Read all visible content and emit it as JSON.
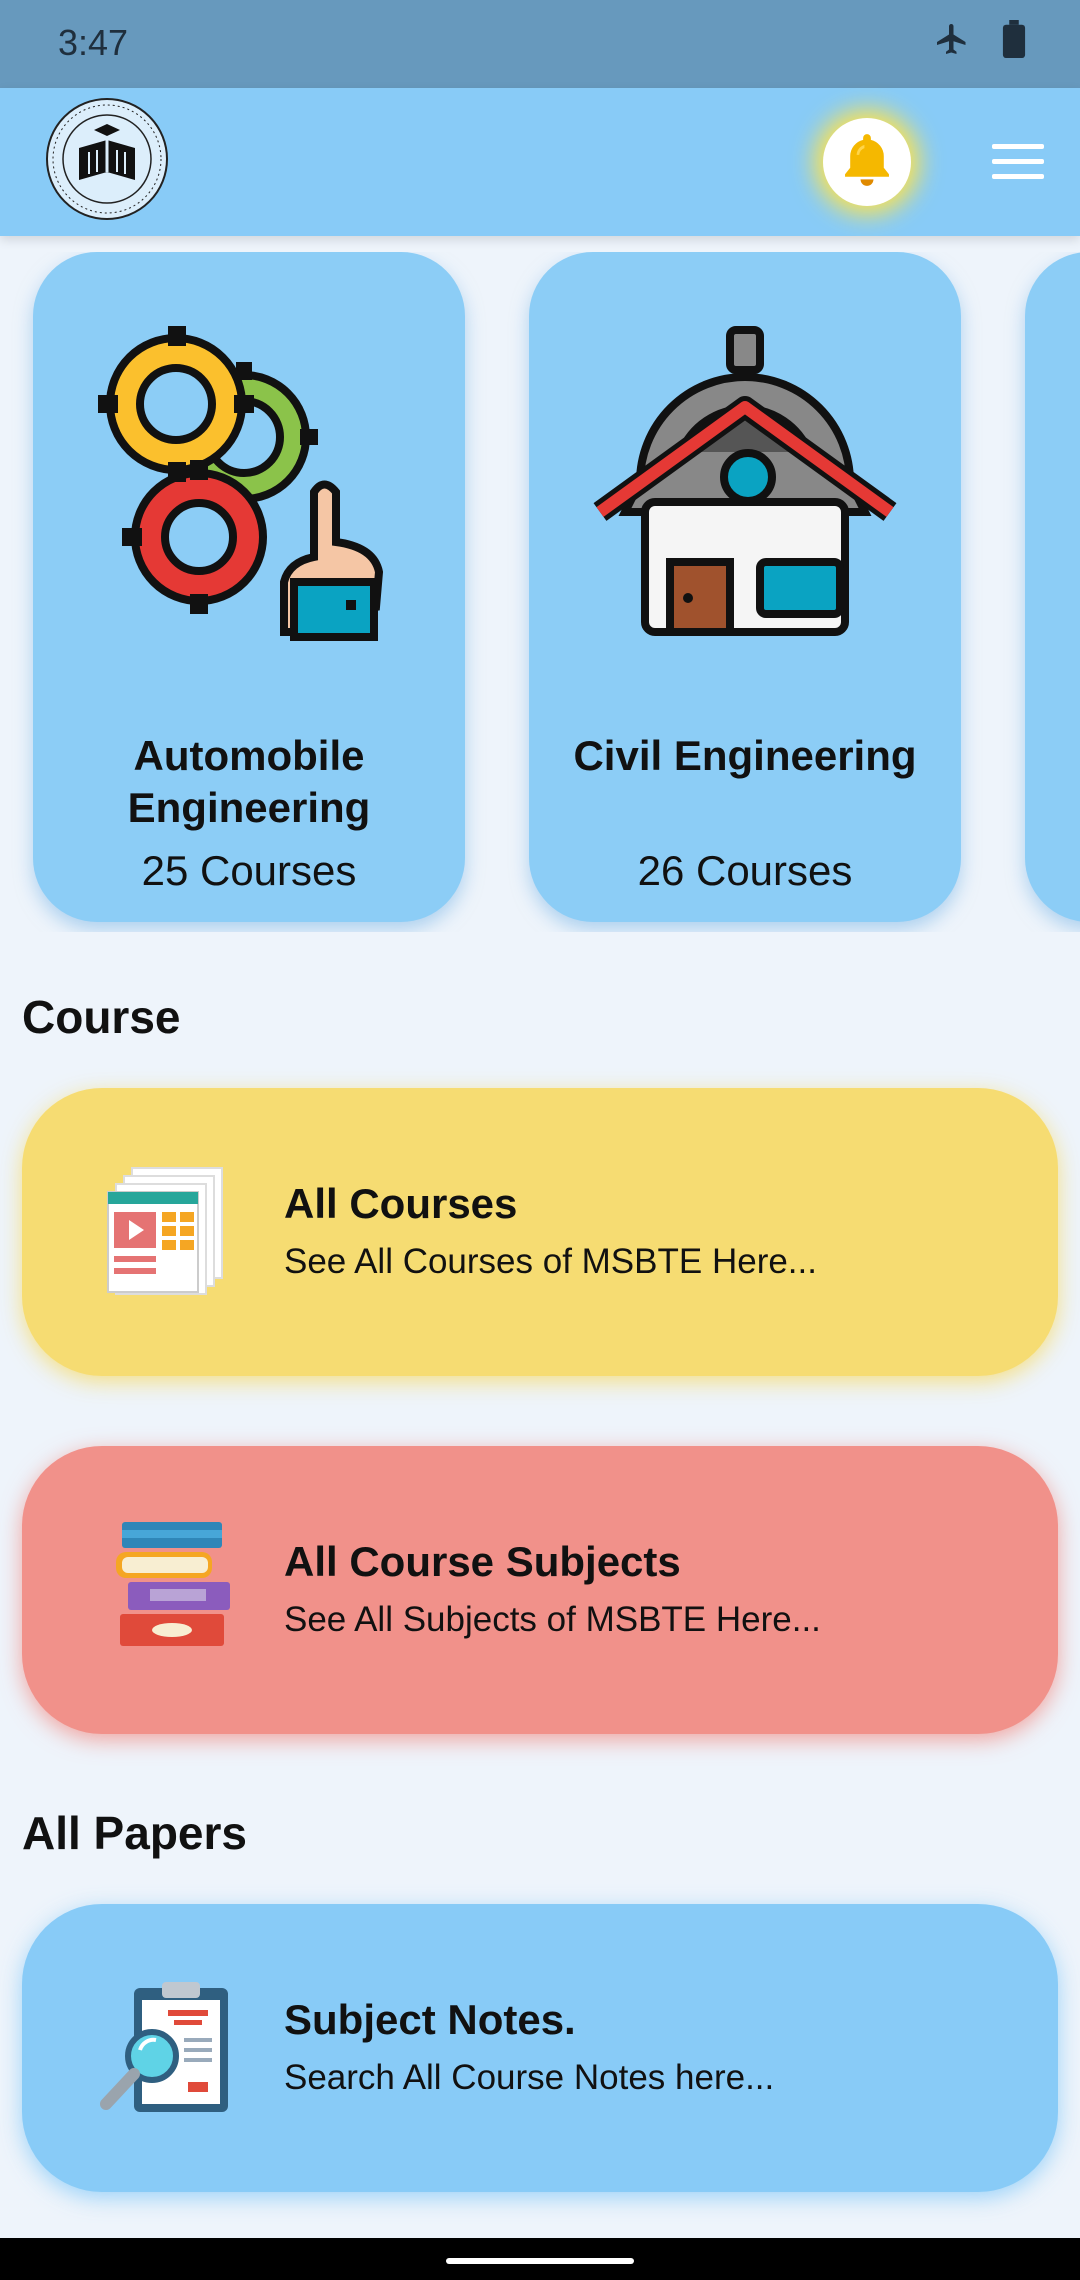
{
  "status_bar": {
    "time": "3:47",
    "icons": [
      "airplane-icon",
      "battery-icon"
    ]
  },
  "app_bar": {
    "logo": "msbte-seal-logo",
    "notification_icon": "bell-icon",
    "menu_icon": "hamburger-menu-icon"
  },
  "categories": [
    {
      "title": "Automobile Engineering",
      "count": "25 Courses",
      "icon": "gears-icon"
    },
    {
      "title": "Civil Engineering",
      "count": "26 Courses",
      "icon": "house-gear-icon"
    }
  ],
  "sections": {
    "course_heading": "Course",
    "papers_heading": "All Papers"
  },
  "cards": {
    "all_courses": {
      "title": "All Courses",
      "subtitle": "See All Courses of MSBTE Here...",
      "color": "#f6dc72",
      "icon": "course-media-icon"
    },
    "all_subjects": {
      "title": "All Course Subjects",
      "subtitle": "See All Subjects of MSBTE Here...",
      "color": "#f1918a",
      "icon": "book-stack-icon"
    },
    "subject_notes": {
      "title": "Subject Notes.",
      "subtitle": "Search All Course Notes here...",
      "color": "#88cbf7",
      "icon": "clipboard-search-icon"
    }
  },
  "colors": {
    "status_bar": "#6799bd",
    "app_bar": "#88cbf7",
    "background": "#eef4fb"
  }
}
